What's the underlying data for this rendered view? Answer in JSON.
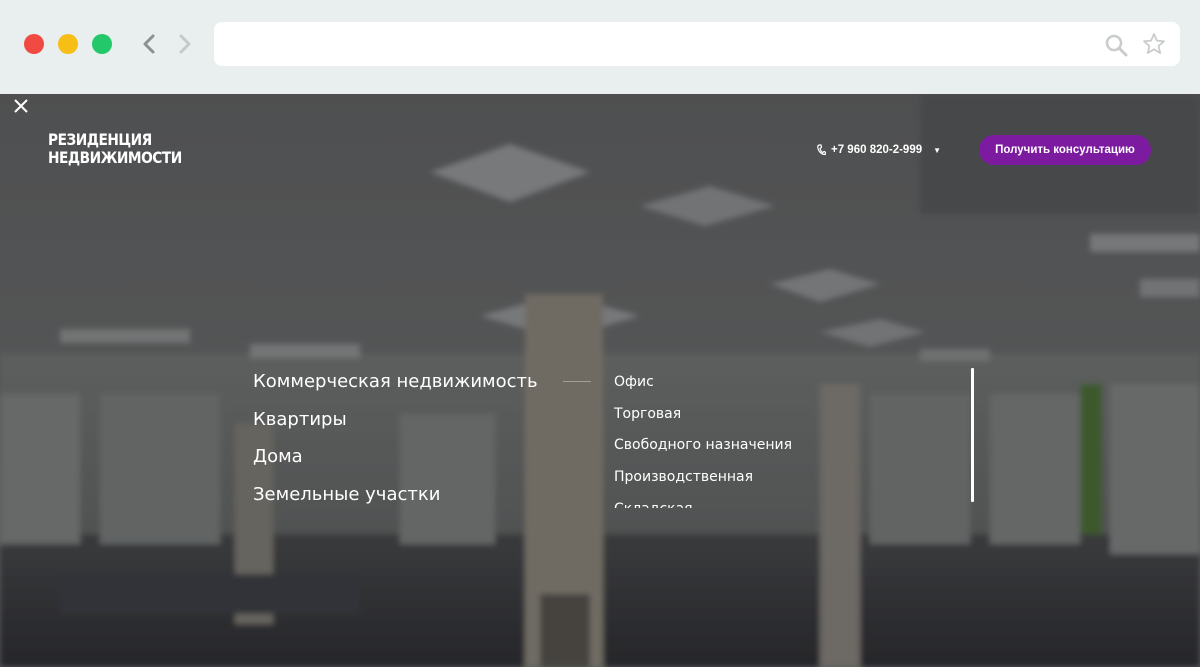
{
  "header": {
    "logo": [
      "РЕЗИДЕНЦИЯ",
      "НЕДВИЖИМОСТИ"
    ],
    "phone": "+7 960 820-2-999",
    "cta_label": "Получить консультацию"
  },
  "menu": {
    "categories": [
      "Коммерческая недвижимость",
      "Квартиры",
      "Дома",
      "Земельные участки"
    ],
    "active_category": "Коммерческая недвижимость",
    "subcategories": [
      "Офис",
      "Торговая",
      "Свободного назначения",
      "Производственная",
      "Складская"
    ]
  },
  "colors": {
    "accent": "#7d1ba0",
    "chrome": "#e9eeee"
  },
  "icons": {
    "close": "close-icon",
    "phone": "phone-icon",
    "search": "search-icon",
    "star": "star-icon"
  }
}
